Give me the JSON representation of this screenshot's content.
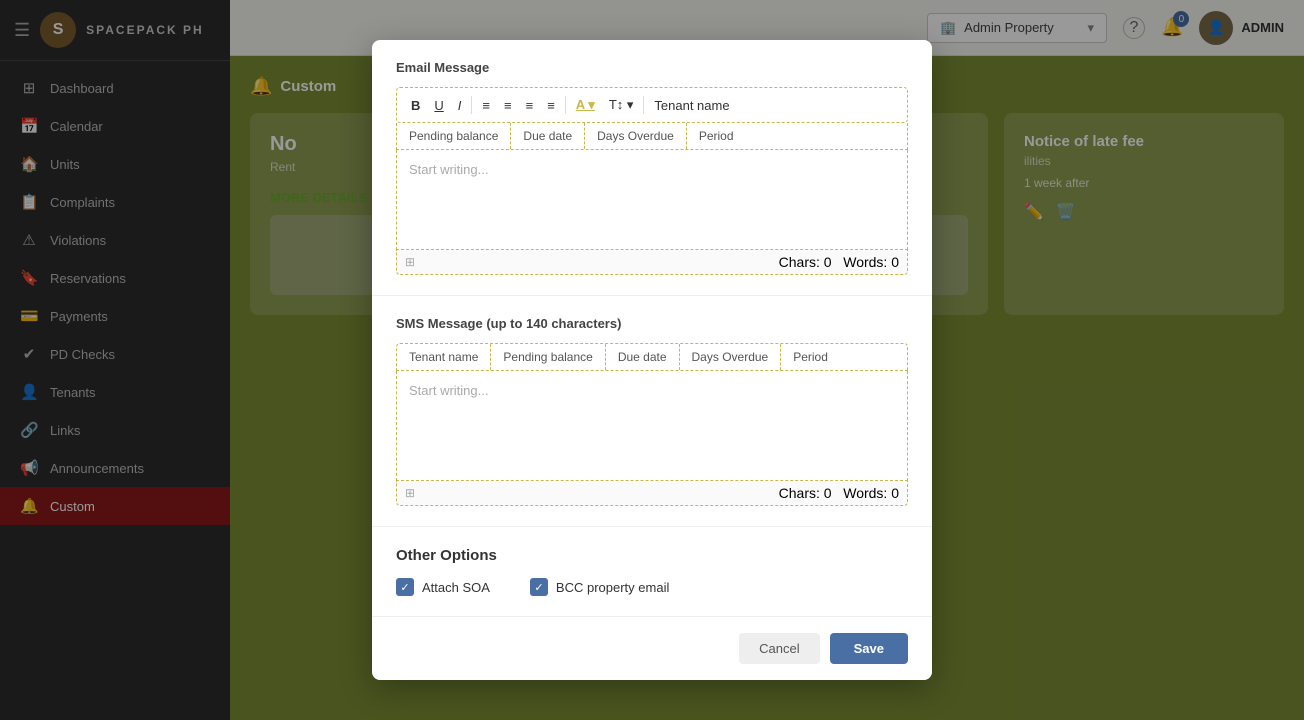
{
  "sidebar": {
    "brand": "SPACEPACK PH",
    "logo_letter": "S",
    "items": [
      {
        "id": "dashboard",
        "label": "Dashboard",
        "icon": "⊞"
      },
      {
        "id": "calendar",
        "label": "Calendar",
        "icon": "📅"
      },
      {
        "id": "units",
        "label": "Units",
        "icon": "🏠"
      },
      {
        "id": "complaints",
        "label": "Complaints",
        "icon": "📋"
      },
      {
        "id": "violations",
        "label": "Violations",
        "icon": "⚠"
      },
      {
        "id": "reservations",
        "label": "Reservations",
        "icon": "🔖"
      },
      {
        "id": "payments",
        "label": "Payments",
        "icon": "💳"
      },
      {
        "id": "pd-checks",
        "label": "PD Checks",
        "icon": "✔"
      },
      {
        "id": "tenants",
        "label": "Tenants",
        "icon": "👤"
      },
      {
        "id": "links",
        "label": "Links",
        "icon": "🔗"
      },
      {
        "id": "announcements",
        "label": "Announcements",
        "icon": "📢"
      },
      {
        "id": "custom",
        "label": "Custom",
        "icon": "🔔",
        "active": true
      }
    ]
  },
  "topbar": {
    "property_label": "Admin Property",
    "property_icon": "🏢",
    "help_icon": "?",
    "notifications_badge": "0",
    "admin_label": "ADMIN"
  },
  "breadcrumb": {
    "bell_icon": "🔔",
    "title": "Custom"
  },
  "background_card": {
    "title": "No",
    "subtitle": "Rent",
    "more_details": "MORE DETAILS"
  },
  "notice_card": {
    "title": "Notice of late fee",
    "subtitle": "ilities",
    "timing": "1 week after"
  },
  "modal": {
    "email_section_label": "Email Message",
    "toolbar": {
      "bold": "B",
      "italic": "I",
      "underline": "U",
      "align_left": "≡",
      "align_center": "≡",
      "align_right": "≡",
      "align_justify": "≡",
      "font_color_label": "A",
      "font_size_label": "T↕",
      "tag_tenant": "Tenant name",
      "tag_pending": "Pending balance",
      "tag_due": "Due date",
      "tag_overdue": "Days Overdue",
      "tag_period": "Period"
    },
    "email_placeholder": "Start writing...",
    "email_chars": "Chars: 0",
    "email_words": "Words: 0",
    "sms_section_label": "SMS Message (up to 140 characters)",
    "sms_tags": {
      "tenant": "Tenant name",
      "pending": "Pending balance",
      "due": "Due date",
      "overdue": "Days Overdue",
      "period": "Period"
    },
    "sms_placeholder": "Start writing...",
    "sms_chars": "Chars: 0",
    "sms_words": "Words: 0",
    "other_options_label": "Other Options",
    "attach_soa_label": "Attach SOA",
    "bcc_email_label": "BCC property email",
    "footer_save": "Save",
    "footer_cancel": "Cancel"
  }
}
